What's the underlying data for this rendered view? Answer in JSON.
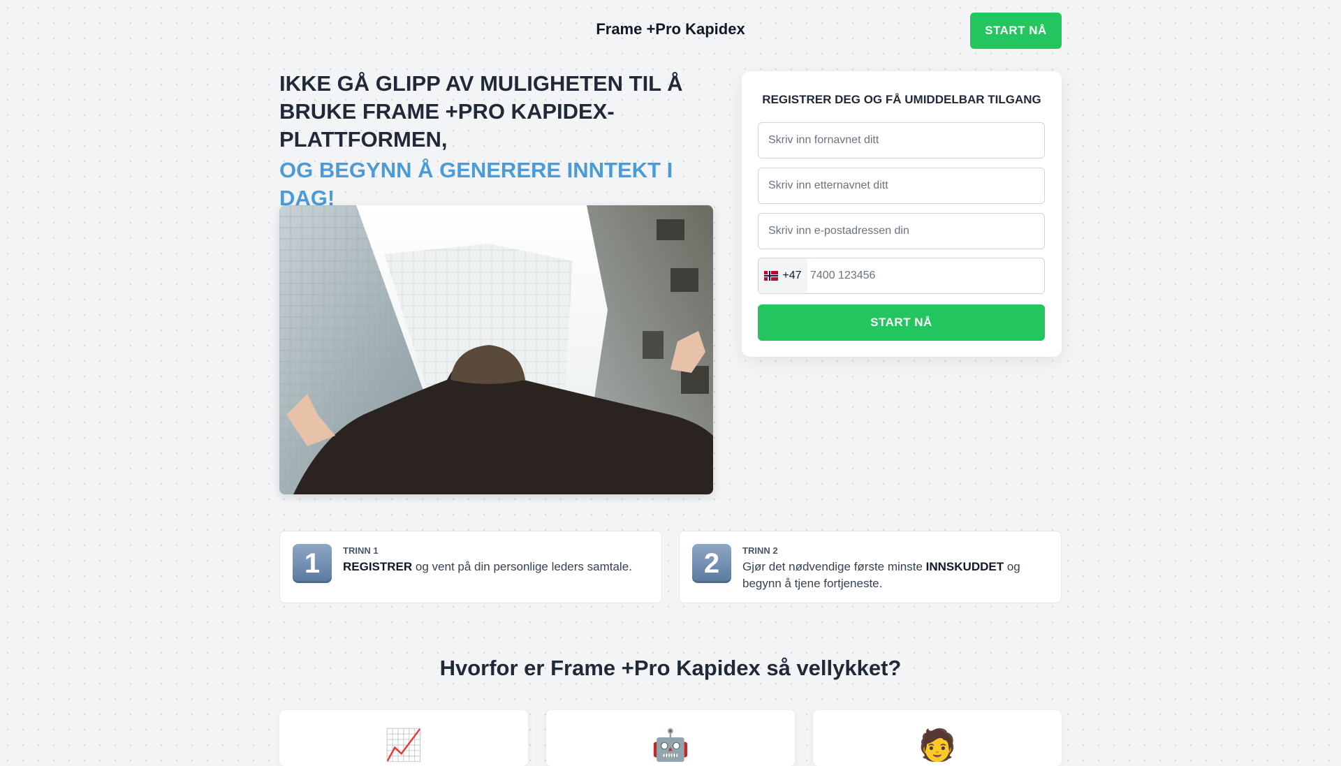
{
  "header": {
    "title": "Frame +Pro Kapidex",
    "cta_label": "START NÅ"
  },
  "hero": {
    "headline": "IKKE GÅ GLIPP AV MULIGHETEN TIL Å BRUKE FRAME +PRO KAPIDEX-PLATTFORMEN,",
    "headline_accent": "OG BEGYNN Å GENERERE INNTEKT I DAG!",
    "accent_color": "#4c9bd6"
  },
  "form": {
    "title": "REGISTRER DEG OG FÅ UMIDDELBAR TILGANG",
    "first_name_placeholder": "Skriv inn fornavnet ditt",
    "last_name_placeholder": "Skriv inn etternavnet ditt",
    "email_placeholder": "Skriv inn e-postadressen din",
    "phone_country_code": "+47",
    "phone_flag": "norway-flag-icon",
    "phone_placeholder": "7400 123456",
    "submit_label": "START NÅ",
    "button_color": "#22c55e"
  },
  "steps": [
    {
      "number": "1",
      "label": "TRINN 1",
      "bold": "REGISTRER",
      "text": " og vent på din personlige leders samtale."
    },
    {
      "number": "2",
      "label": "TRINN 2",
      "text_before": "Gjør det nødvendige første minste ",
      "bold": "INNSKUDDET",
      "text_after": " og begynn å tjene fortjeneste."
    }
  ],
  "why": {
    "title": "Hvorfor er Frame +Pro Kapidex så vellykket?",
    "cards": [
      {
        "icon": "chart-increasing-icon",
        "glyph": "📈"
      },
      {
        "icon": "robot-icon",
        "glyph": "🤖"
      },
      {
        "icon": "person-icon",
        "glyph": "🧑"
      }
    ]
  }
}
